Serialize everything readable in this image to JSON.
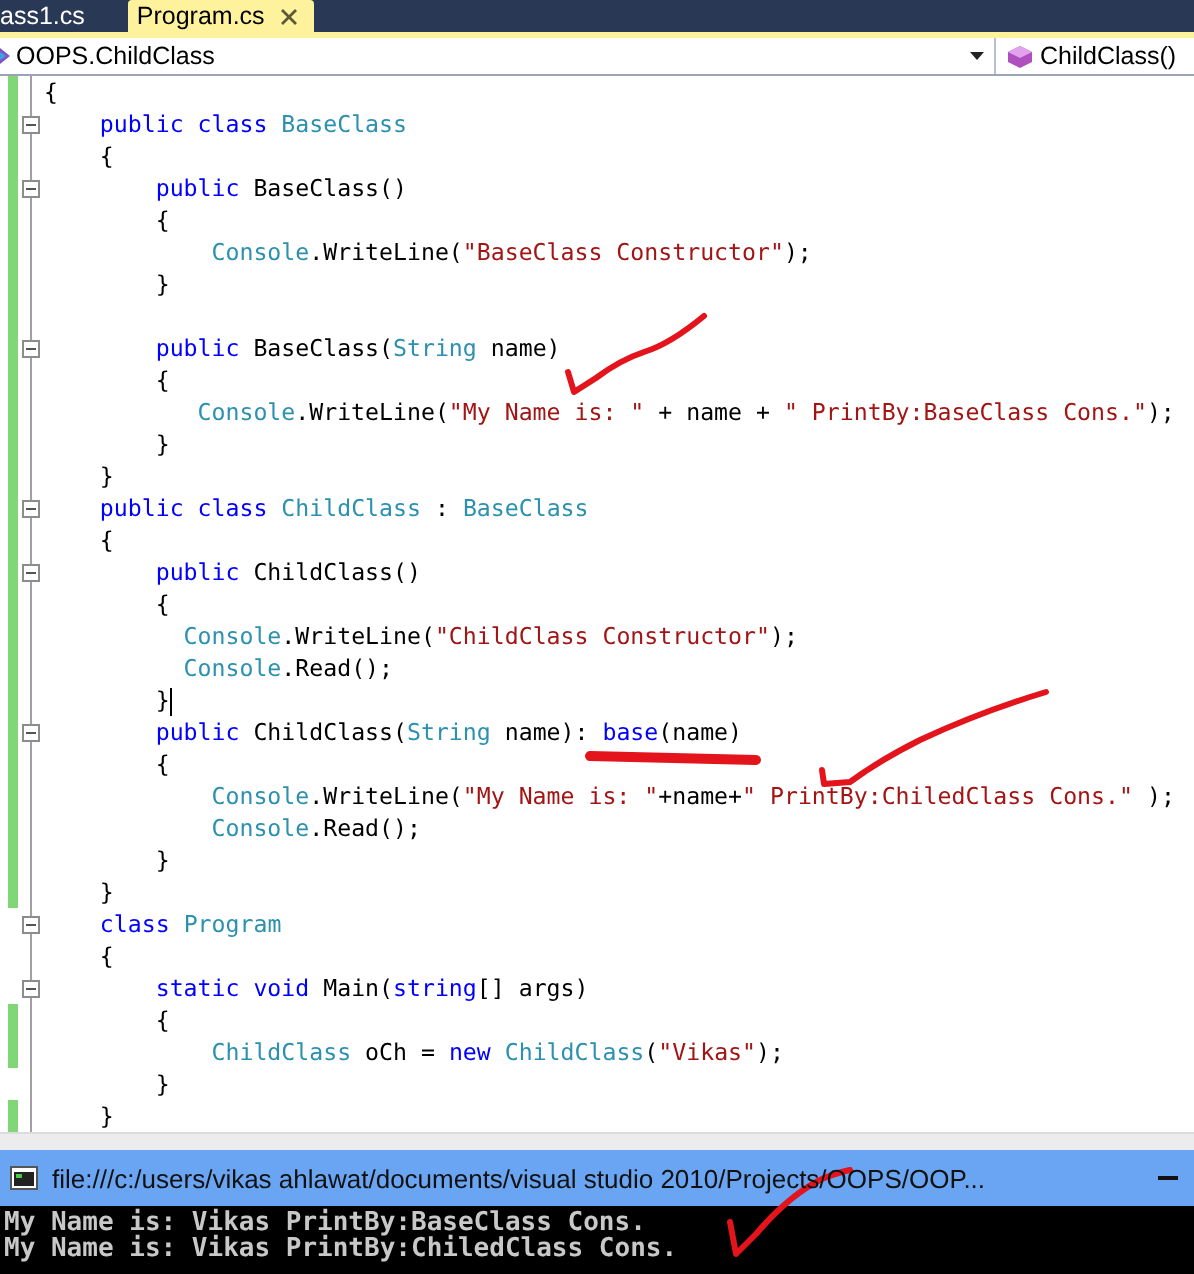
{
  "tabs": [
    {
      "label": "ass1.cs",
      "selected": false,
      "closable": false
    },
    {
      "label": "Program.cs",
      "selected": true,
      "closable": true
    }
  ],
  "nav_bar": {
    "type_selector": "OOPS.ChildClass",
    "member_selector": "ChildClass()"
  },
  "editor": {
    "lines": [
      {
        "changed": true,
        "fold": false,
        "caret": false,
        "tokens": [
          {
            "kind": "plain",
            "text": "{"
          }
        ]
      },
      {
        "changed": true,
        "fold": true,
        "caret": false,
        "tokens": [
          {
            "kind": "kw",
            "text": "    public class "
          },
          {
            "kind": "type",
            "text": "BaseClass"
          }
        ]
      },
      {
        "changed": true,
        "fold": false,
        "caret": false,
        "tokens": [
          {
            "kind": "plain",
            "text": "    {"
          }
        ]
      },
      {
        "changed": true,
        "fold": true,
        "caret": false,
        "tokens": [
          {
            "kind": "kw",
            "text": "        public "
          },
          {
            "kind": "plain",
            "text": "BaseClass()"
          }
        ]
      },
      {
        "changed": true,
        "fold": false,
        "caret": false,
        "tokens": [
          {
            "kind": "plain",
            "text": "        {"
          }
        ]
      },
      {
        "changed": true,
        "fold": false,
        "caret": false,
        "tokens": [
          {
            "kind": "type",
            "text": "            Console"
          },
          {
            "kind": "plain",
            "text": ".WriteLine("
          },
          {
            "kind": "str",
            "text": "\"BaseClass Constructor\""
          },
          {
            "kind": "plain",
            "text": ");"
          }
        ]
      },
      {
        "changed": true,
        "fold": false,
        "caret": false,
        "tokens": [
          {
            "kind": "plain",
            "text": "        }"
          }
        ]
      },
      {
        "changed": true,
        "fold": false,
        "caret": false
      },
      {
        "changed": true,
        "fold": true,
        "caret": false,
        "tokens": [
          {
            "kind": "kw",
            "text": "        public "
          },
          {
            "kind": "plain",
            "text": "BaseClass("
          },
          {
            "kind": "type",
            "text": "String"
          },
          {
            "kind": "plain",
            "text": " name)"
          }
        ]
      },
      {
        "changed": true,
        "fold": false,
        "caret": false,
        "tokens": [
          {
            "kind": "plain",
            "text": "        {"
          }
        ]
      },
      {
        "changed": true,
        "fold": false,
        "caret": false,
        "tokens": [
          {
            "kind": "type",
            "text": "           Console"
          },
          {
            "kind": "plain",
            "text": ".WriteLine("
          },
          {
            "kind": "str",
            "text": "\"My Name is: \""
          },
          {
            "kind": "plain",
            "text": " + name + "
          },
          {
            "kind": "str",
            "text": "\" PrintBy:BaseClass Cons.\""
          },
          {
            "kind": "plain",
            "text": ");"
          }
        ]
      },
      {
        "changed": true,
        "fold": false,
        "caret": false,
        "tokens": [
          {
            "kind": "plain",
            "text": "        }"
          }
        ]
      },
      {
        "changed": true,
        "fold": false,
        "caret": false,
        "tokens": [
          {
            "kind": "plain",
            "text": "    }"
          }
        ]
      },
      {
        "changed": true,
        "fold": true,
        "caret": false,
        "tokens": [
          {
            "kind": "kw",
            "text": "    public class "
          },
          {
            "kind": "type",
            "text": "ChildClass"
          },
          {
            "kind": "plain",
            "text": " : "
          },
          {
            "kind": "type",
            "text": "BaseClass"
          }
        ]
      },
      {
        "changed": true,
        "fold": false,
        "caret": false,
        "tokens": [
          {
            "kind": "plain",
            "text": "    {"
          }
        ]
      },
      {
        "changed": true,
        "fold": true,
        "caret": false,
        "tokens": [
          {
            "kind": "kw",
            "text": "        public "
          },
          {
            "kind": "plain",
            "text": "ChildClass()"
          }
        ]
      },
      {
        "changed": true,
        "fold": false,
        "caret": false,
        "tokens": [
          {
            "kind": "plain",
            "text": "        {"
          }
        ]
      },
      {
        "changed": true,
        "fold": false,
        "caret": false,
        "tokens": [
          {
            "kind": "type",
            "text": "          Console"
          },
          {
            "kind": "plain",
            "text": ".WriteLine("
          },
          {
            "kind": "str",
            "text": "\"ChildClass Constructor\""
          },
          {
            "kind": "plain",
            "text": ");"
          }
        ]
      },
      {
        "changed": true,
        "fold": false,
        "caret": false,
        "tokens": [
          {
            "kind": "type",
            "text": "          Console"
          },
          {
            "kind": "plain",
            "text": ".Read();"
          }
        ]
      },
      {
        "changed": true,
        "fold": false,
        "caret": true,
        "tokens": [
          {
            "kind": "plain",
            "text": "        }"
          }
        ]
      },
      {
        "changed": true,
        "fold": true,
        "caret": false,
        "tokens": [
          {
            "kind": "kw",
            "text": "        public "
          },
          {
            "kind": "plain",
            "text": "ChildClass("
          },
          {
            "kind": "type",
            "text": "String"
          },
          {
            "kind": "plain",
            "text": " name): "
          },
          {
            "kind": "kw",
            "text": "base"
          },
          {
            "kind": "plain",
            "text": "(name)"
          }
        ]
      },
      {
        "changed": true,
        "fold": false,
        "caret": false,
        "tokens": [
          {
            "kind": "plain",
            "text": "        {"
          }
        ]
      },
      {
        "changed": true,
        "fold": false,
        "caret": false,
        "tokens": [
          {
            "kind": "type",
            "text": "            Console"
          },
          {
            "kind": "plain",
            "text": ".WriteLine("
          },
          {
            "kind": "str",
            "text": "\"My Name is: \""
          },
          {
            "kind": "plain",
            "text": "+name+"
          },
          {
            "kind": "str",
            "text": "\" PrintBy:ChiledClass Cons.\""
          },
          {
            "kind": "plain",
            "text": " );"
          }
        ]
      },
      {
        "changed": true,
        "fold": false,
        "caret": false,
        "tokens": [
          {
            "kind": "type",
            "text": "            Console"
          },
          {
            "kind": "plain",
            "text": ".Read();"
          }
        ]
      },
      {
        "changed": true,
        "fold": false,
        "caret": false,
        "tokens": [
          {
            "kind": "plain",
            "text": "        }"
          }
        ]
      },
      {
        "changed": true,
        "fold": false,
        "caret": false,
        "tokens": [
          {
            "kind": "plain",
            "text": "    }"
          }
        ]
      },
      {
        "changed": false,
        "fold": true,
        "caret": false,
        "tokens": [
          {
            "kind": "kw",
            "text": "    class "
          },
          {
            "kind": "type",
            "text": "Program"
          }
        ]
      },
      {
        "changed": false,
        "fold": false,
        "caret": false,
        "tokens": [
          {
            "kind": "plain",
            "text": "    {"
          }
        ]
      },
      {
        "changed": false,
        "fold": true,
        "caret": false,
        "tokens": [
          {
            "kind": "kw",
            "text": "        static void "
          },
          {
            "kind": "plain",
            "text": "Main("
          },
          {
            "kind": "kw",
            "text": "string"
          },
          {
            "kind": "plain",
            "text": "[] args)"
          }
        ]
      },
      {
        "changed": true,
        "fold": false,
        "caret": false,
        "tokens": [
          {
            "kind": "plain",
            "text": "        {"
          }
        ]
      },
      {
        "changed": true,
        "fold": false,
        "caret": false,
        "tokens": [
          {
            "kind": "type",
            "text": "            ChildClass"
          },
          {
            "kind": "plain",
            "text": " oCh = "
          },
          {
            "kind": "kw",
            "text": "new "
          },
          {
            "kind": "type",
            "text": "ChildClass"
          },
          {
            "kind": "plain",
            "text": "("
          },
          {
            "kind": "str",
            "text": "\"Vikas\""
          },
          {
            "kind": "plain",
            "text": ");"
          }
        ]
      },
      {
        "changed": false,
        "fold": false,
        "caret": false,
        "tokens": [
          {
            "kind": "plain",
            "text": "        }"
          }
        ]
      },
      {
        "changed": true,
        "fold": false,
        "caret": false,
        "tokens": [
          {
            "kind": "plain",
            "text": "    }"
          }
        ]
      }
    ]
  },
  "console": {
    "title": "file:///c:/users/vikas ahlawat/documents/visual studio 2010/Projects/OOPS/OOP...",
    "output": [
      "My Name is: Vikas PrintBy:BaseClass Cons.",
      "My Name is: Vikas PrintBy:ChiledClass Cons."
    ]
  }
}
